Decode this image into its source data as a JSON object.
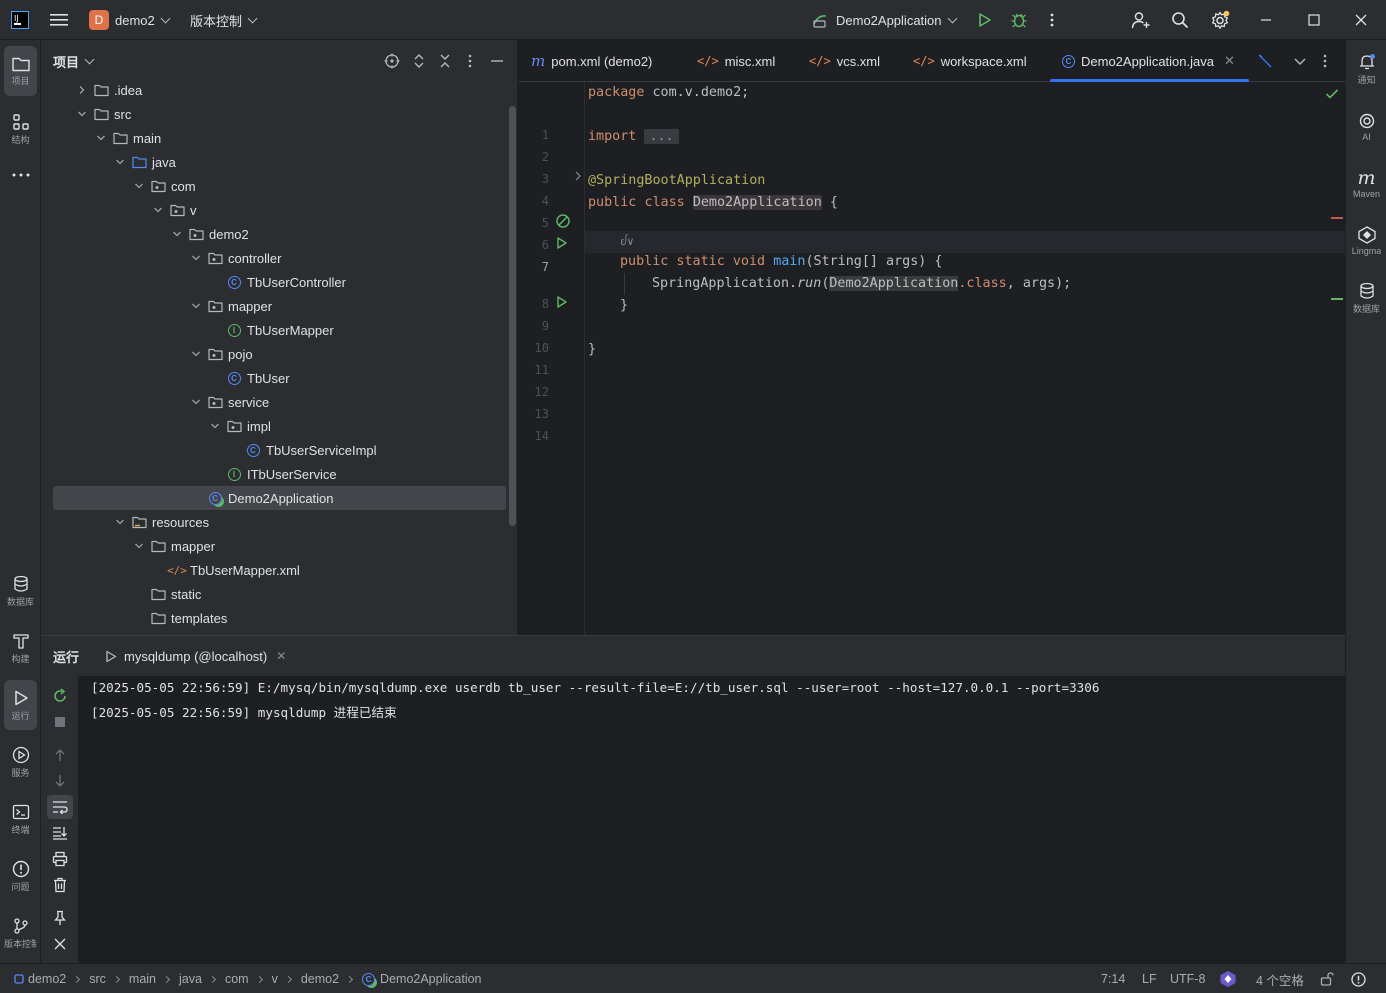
{
  "titlebar": {
    "project_badge": "D",
    "project_name": "demo2",
    "vcs_menu": "版本控制",
    "run_config": "Demo2Application"
  },
  "left_strip": [
    {
      "label": "项目",
      "icon": "folder-icon"
    },
    {
      "label": "结构",
      "icon": "structure-icon"
    },
    {
      "label": "数据库",
      "icon": "database-icon"
    },
    {
      "label": "构建",
      "icon": "build-icon"
    },
    {
      "label": "运行",
      "icon": "run-icon"
    },
    {
      "label": "服务",
      "icon": "services-icon"
    },
    {
      "label": "终端",
      "icon": "terminal-icon"
    },
    {
      "label": "问题",
      "icon": "problems-icon"
    },
    {
      "label": "版本控制",
      "icon": "git-icon"
    }
  ],
  "right_strip": [
    {
      "label": "通知",
      "icon": "bell-icon"
    },
    {
      "label": "AI",
      "icon": "ai-icon"
    },
    {
      "label": "Maven",
      "icon": "maven-icon"
    },
    {
      "label": "Lingma",
      "icon": "lingma-icon"
    },
    {
      "label": "数据库",
      "icon": "database-icon"
    }
  ],
  "project_panel": {
    "title": "项目",
    "tree": [
      {
        "label": ".idea",
        "depth": 0,
        "expanded": false,
        "type": "folder"
      },
      {
        "label": "src",
        "depth": 0,
        "expanded": true,
        "type": "folder"
      },
      {
        "label": "main",
        "depth": 1,
        "expanded": true,
        "type": "folder"
      },
      {
        "label": "java",
        "depth": 2,
        "expanded": true,
        "type": "source-folder"
      },
      {
        "label": "com",
        "depth": 3,
        "expanded": true,
        "type": "package"
      },
      {
        "label": "v",
        "depth": 4,
        "expanded": true,
        "type": "package"
      },
      {
        "label": "demo2",
        "depth": 5,
        "expanded": true,
        "type": "package"
      },
      {
        "label": "controller",
        "depth": 6,
        "expanded": true,
        "type": "package"
      },
      {
        "label": "TbUserController",
        "depth": 7,
        "type": "class"
      },
      {
        "label": "mapper",
        "depth": 6,
        "expanded": true,
        "type": "package"
      },
      {
        "label": "TbUserMapper",
        "depth": 7,
        "type": "interface"
      },
      {
        "label": "pojo",
        "depth": 6,
        "expanded": true,
        "type": "package"
      },
      {
        "label": "TbUser",
        "depth": 7,
        "type": "class"
      },
      {
        "label": "service",
        "depth": 6,
        "expanded": true,
        "type": "package"
      },
      {
        "label": "impl",
        "depth": 7,
        "expanded": true,
        "type": "package"
      },
      {
        "label": "TbUserServiceImpl",
        "depth": 8,
        "type": "class"
      },
      {
        "label": "ITbUserService",
        "depth": 7,
        "type": "interface"
      },
      {
        "label": "Demo2Application",
        "depth": 6,
        "type": "spring-class",
        "selected": true
      },
      {
        "label": "resources",
        "depth": 2,
        "expanded": true,
        "type": "resource-folder"
      },
      {
        "label": "mapper",
        "depth": 3,
        "expanded": true,
        "type": "folder"
      },
      {
        "label": "TbUserMapper.xml",
        "depth": 4,
        "type": "xml"
      },
      {
        "label": "static",
        "depth": 3,
        "type": "folder"
      },
      {
        "label": "templates",
        "depth": 3,
        "type": "folder"
      }
    ]
  },
  "editor": {
    "tabs": [
      {
        "label": "pom.xml (demo2)",
        "icon": "m",
        "type": "maven"
      },
      {
        "label": "misc.xml",
        "icon": "</>",
        "type": "xml"
      },
      {
        "label": "vcs.xml",
        "icon": "</>",
        "type": "xml"
      },
      {
        "label": "workspace.xml",
        "icon": "</>",
        "type": "xml"
      },
      {
        "label": "Demo2Application.java",
        "icon": "C",
        "type": "spring-class",
        "active": true
      }
    ],
    "line_numbers": [
      "1",
      "2",
      "3",
      "4",
      "5",
      "6",
      "7",
      "8",
      "9",
      "10",
      "11",
      "12",
      "13",
      "14"
    ],
    "current_line": "7",
    "code": {
      "l1_kw": "package",
      "l1_rest": " com.v.demo2;",
      "l3_kw": "import",
      "l3_fold": "...",
      "l6_ann": "@SpringBootApplication",
      "l7_kw1": "public",
      "l7_kw2": "class",
      "l7_name": "Demo2Application",
      "l7_rest": " {",
      "l8_hint": "ᩀ∨",
      "l9_kw": "public static void",
      "l9_fn": "main",
      "l9_rest": "(String[] args) {",
      "l10_pre": "SpringApplication.",
      "l10_fn": "run",
      "l10_arg": "Demo2Application",
      "l10_kw": ".class",
      "l10_rest": ", args);",
      "l11": "}",
      "l13": "}"
    }
  },
  "run_panel": {
    "title": "运行",
    "tab_label": "mysqldump (@localhost)",
    "lines": [
      "[2025-05-05 22:56:59] E:/mysq/bin/mysqldump.exe userdb tb_user --result-file=E://tb_user.sql --user=root --host=127.0.0.1 --port=3306",
      "[2025-05-05 22:56:59] mysqldump 进程已结束"
    ]
  },
  "statusbar": {
    "breadcrumbs": [
      "demo2",
      "src",
      "main",
      "java",
      "com",
      "v",
      "demo2",
      "Demo2Application"
    ],
    "position": "7:14",
    "line_sep": "LF",
    "encoding": "UTF-8",
    "indent": "4 个空格"
  },
  "colors": {
    "accent": "#3574f0",
    "run_green": "#5fb865",
    "project_badge": "#e0724a"
  }
}
